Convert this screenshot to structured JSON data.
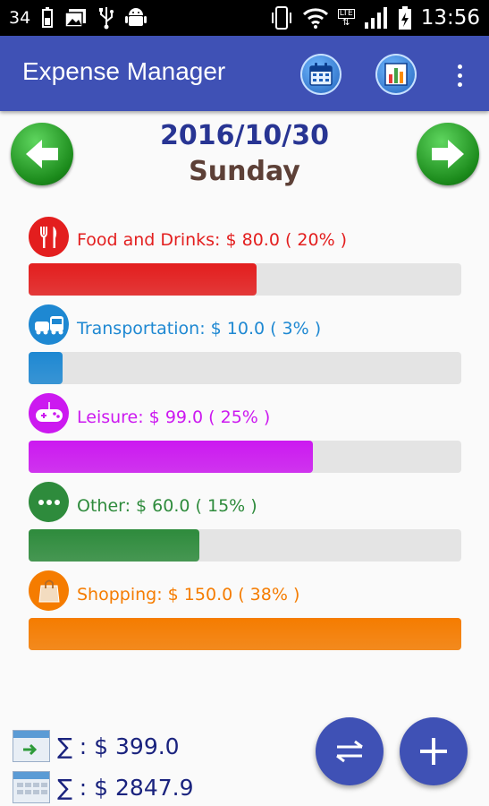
{
  "status_bar": {
    "notification_count": "34",
    "time": "13:56",
    "network_label": "LTE"
  },
  "app_bar": {
    "title": "Expense Manager"
  },
  "date_nav": {
    "date": "2016/10/30",
    "day": "Sunday"
  },
  "categories": [
    {
      "label": "Food and Drinks: $ 80.0 ( 20% )",
      "percent": 20,
      "color": "#e31e1e",
      "icon": "fork-knife-icon"
    },
    {
      "label": "Transportation: $ 10.0 ( 3% )",
      "percent": 3,
      "color": "#1e88d2",
      "icon": "car-bus-icon"
    },
    {
      "label": "Leisure: $ 99.0 ( 25% )",
      "percent": 25,
      "color": "#cc19f0",
      "icon": "gamepad-icon"
    },
    {
      "label": "Other: $ 60.0 ( 15% )",
      "percent": 15,
      "color": "#2e8b3c",
      "icon": "more-dots-icon"
    },
    {
      "label": "Shopping: $ 150.0 ( 38% )",
      "percent": 38,
      "color": "#f57c00",
      "icon": "shopping-bag-icon"
    }
  ],
  "footer": {
    "daily_total": "∑  : $ 399.0",
    "period_total": "∑  : $ 2847.9"
  }
}
